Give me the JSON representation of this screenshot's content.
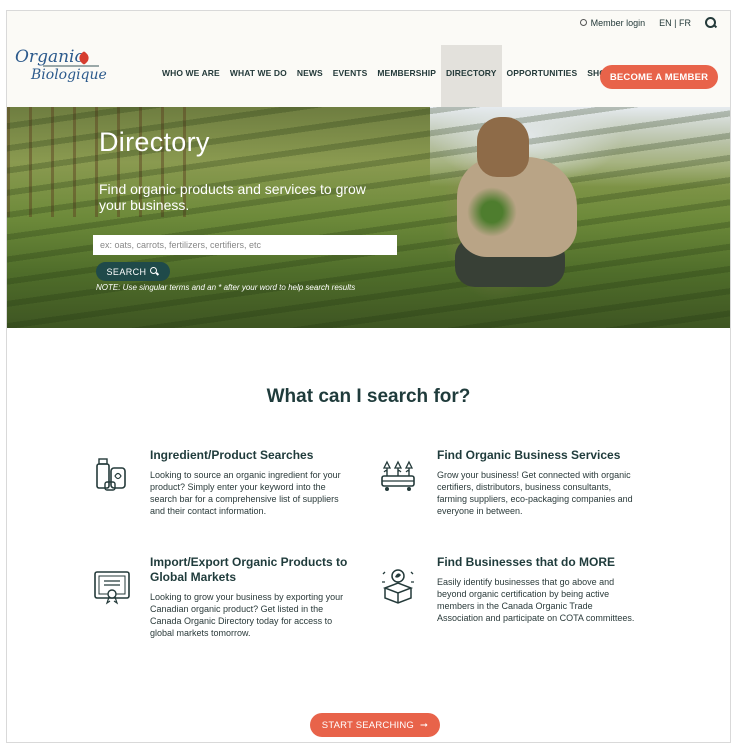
{
  "topbar": {
    "member_login": "Member login",
    "lang": "EN | FR"
  },
  "logo": {
    "line1": "Organic",
    "line2": "Biologique"
  },
  "nav": {
    "items": [
      {
        "label": "WHO WE ARE"
      },
      {
        "label": "WHAT WE DO"
      },
      {
        "label": "NEWS"
      },
      {
        "label": "EVENTS"
      },
      {
        "label": "MEMBERSHIP"
      },
      {
        "label": "DIRECTORY"
      },
      {
        "label": "OPPORTUNITIES"
      },
      {
        "label": "SHOP"
      }
    ],
    "active": "DIRECTORY",
    "cta": "BECOME A MEMBER"
  },
  "hero": {
    "title": "Directory",
    "subtitle": "Find organic products and services to grow your business.",
    "search_placeholder": "ex: oats, carrots, fertilizers, certifiers, etc",
    "search_button": "SEARCH",
    "note": "NOTE: Use singular terms and an * after your word to help search results"
  },
  "main": {
    "title": "What can I search for?",
    "features": [
      {
        "title": "Ingredient/Product Searches",
        "text": "Looking to source an organic ingredient for your product? Simply enter your keyword into the search bar for a comprehensive list of suppliers and their contact information.",
        "icon": "product-jars-icon"
      },
      {
        "title": "Find Organic Business Services",
        "text": "Grow your business! Get connected with organic certifiers, distributors, business consultants, farming suppliers, eco-packaging companies and everyone in between.",
        "icon": "seedlings-tray-icon"
      },
      {
        "title": "Import/Export Organic Products to Global Markets",
        "text": "Looking to grow your business by exporting your Canadian organic product? Get listed in the Canada Organic Directory today for access to global markets tomorrow.",
        "icon": "certificate-icon"
      },
      {
        "title": "Find Businesses that do MORE",
        "text": "Easily identify businesses that go above and beyond organic certification by being active members in the Canada Organic Trade Association and participate on COTA committees.",
        "icon": "eco-box-icon"
      }
    ],
    "cta": "START SEARCHING"
  },
  "colors": {
    "accent": "#e8634a",
    "dark_teal": "#1f4a4a",
    "text": "#1f3b3b"
  }
}
